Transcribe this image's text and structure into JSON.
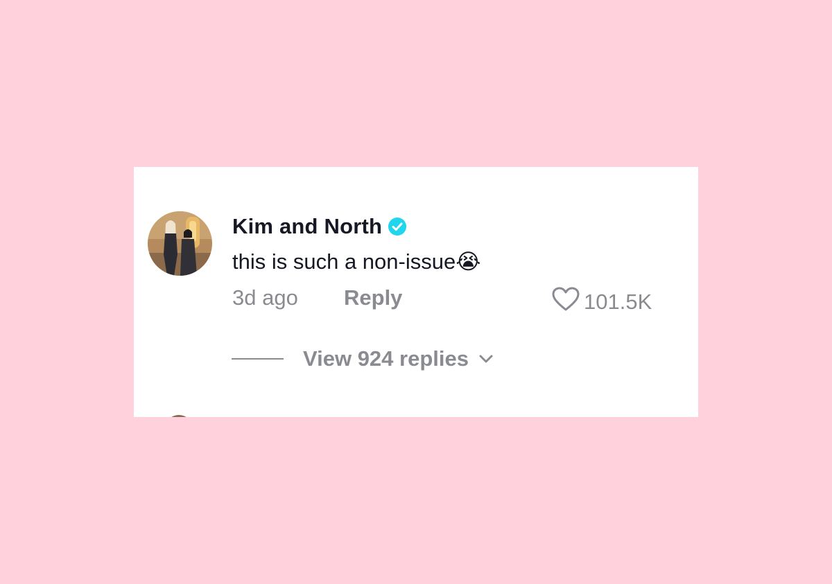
{
  "colors": {
    "page_background": "#ffd1dc",
    "card_background": "#ffffff",
    "primary_text": "#161823",
    "secondary_text": "#8a8b91",
    "verified_badge": "#20d5ec"
  },
  "comment": {
    "avatar_icon": "profile-photo-avatar",
    "username": "Kim and North",
    "verified": true,
    "verified_icon": "verified-check-icon",
    "text": "this is such a non-issue😭",
    "time": "3d ago",
    "reply_label": "Reply",
    "like_icon": "heart-outline-icon",
    "like_count": "101.5K"
  },
  "replies": {
    "label": "View 924 replies",
    "expand_icon": "chevron-down-icon"
  }
}
